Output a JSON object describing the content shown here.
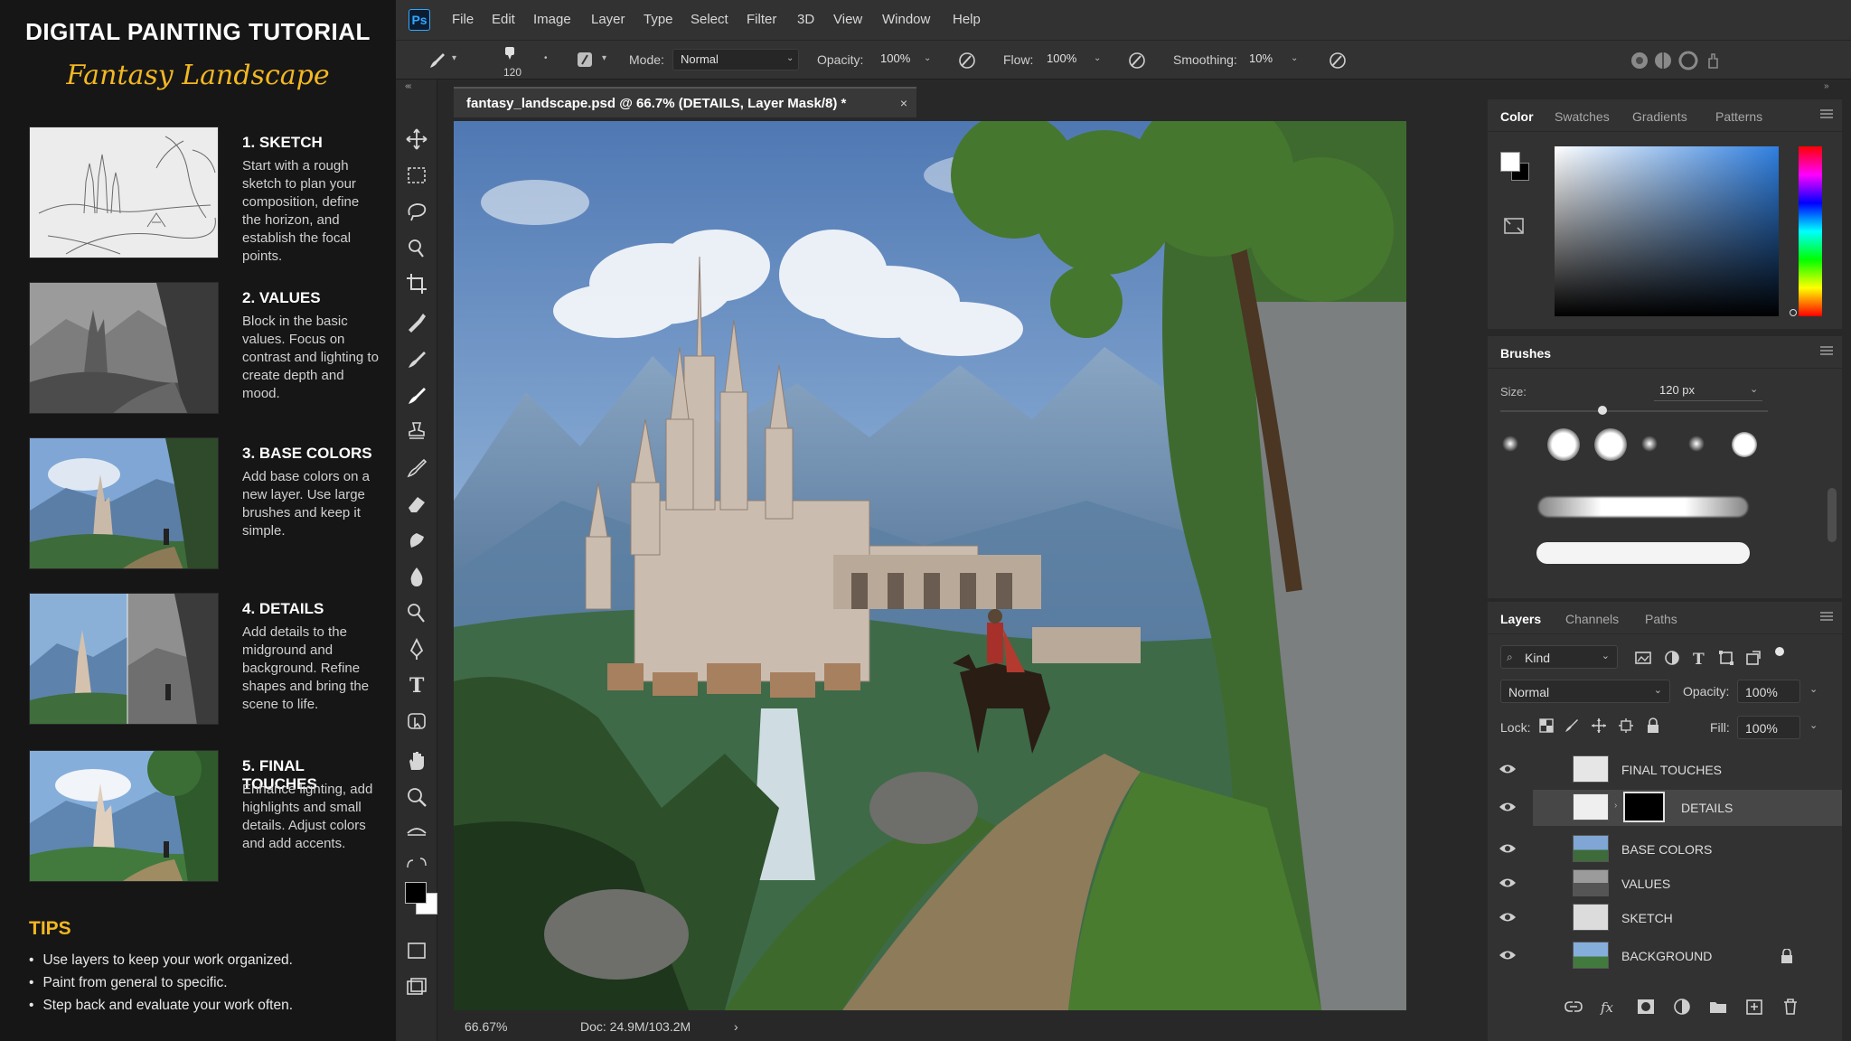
{
  "tutorial": {
    "title": "DIGITAL PAINTING TUTORIAL",
    "subtitle": "Fantasy Landscape",
    "steps": [
      {
        "title": "1. SKETCH",
        "desc": "Start with a rough sketch to plan your composition, define the horizon, and establish the focal points."
      },
      {
        "title": "2. VALUES",
        "desc": "Block in the basic values. Focus on contrast and lighting to create depth and mood."
      },
      {
        "title": "3. BASE COLORS",
        "desc": "Add base colors on a new layer. Use large brushes and keep it simple."
      },
      {
        "title": "4. DETAILS",
        "desc": "Add details to the midground and background. Refine shapes and bring the scene to life."
      },
      {
        "title": "5. FINAL TOUCHES",
        "desc": "Enhance lighting, add highlights and small details. Adjust colors and add accents."
      }
    ],
    "tips_title": "TIPS",
    "tips": [
      "Use layers to keep your work organized.",
      "Paint from general to specific.",
      "Step back and evaluate your work often."
    ]
  },
  "app": {
    "logo": "Ps",
    "menu": [
      "File",
      "Edit",
      "Image",
      "Layer",
      "Type",
      "Select",
      "Filter",
      "3D",
      "View",
      "Window",
      "Help"
    ],
    "options": {
      "brush_size": "120",
      "mode_label": "Mode:",
      "mode_value": "Normal",
      "opacity_label": "Opacity:",
      "opacity_value": "100%",
      "flow_label": "Flow:",
      "flow_value": "100%",
      "smoothing_label": "Smoothing:",
      "smoothing_value": "10%"
    },
    "document": {
      "tab_title": "fantasy_landscape.psd @ 66.7% (DETAILS, Layer Mask/8) *",
      "close": "×"
    },
    "status": {
      "zoom": "66.67%",
      "doc": "Doc: 24.9M/103.2M",
      "arrow": "›"
    },
    "color_panel": {
      "tabs": [
        "Color",
        "Swatches",
        "Gradients",
        "Patterns"
      ]
    },
    "brushes_panel": {
      "title": "Brushes",
      "size_label": "Size:",
      "size_value": "120 px"
    },
    "layers_panel": {
      "tabs": [
        "Layers",
        "Channels",
        "Paths"
      ],
      "kind": "Kind",
      "blend": "Normal",
      "opacity_label": "Opacity:",
      "opacity_value": "100%",
      "lock_label": "Lock:",
      "fill_label": "Fill:",
      "fill_value": "100%",
      "layers": [
        "FINAL TOUCHES",
        "DETAILS",
        "BASE COLORS",
        "VALUES",
        "SKETCH",
        "BACKGROUND"
      ]
    }
  },
  "colors": {
    "accent_yellow": "#f2b722",
    "ps_blue": "#31a8ff",
    "panel_bg": "#323232"
  }
}
